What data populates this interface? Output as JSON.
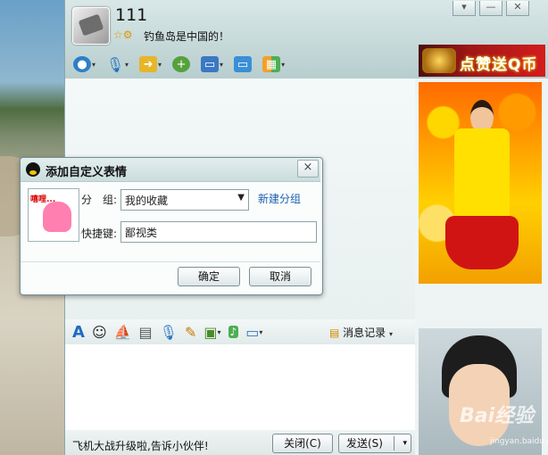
{
  "window": {
    "username": "111",
    "signature": "钓鱼岛是中国的！",
    "status_icons": "☆⚙",
    "buttons": {
      "menu": "▾",
      "minimize": "—",
      "close": "✕"
    }
  },
  "toolbar_top": [
    {
      "name": "video-call",
      "icon": "camera"
    },
    {
      "name": "voice-call",
      "icon": "microphone"
    },
    {
      "name": "send-file",
      "icon": "folder-arrow"
    },
    {
      "name": "add-member",
      "icon": "user-add"
    },
    {
      "name": "remote-assist",
      "icon": "monitor"
    },
    {
      "name": "share-screen",
      "icon": "display"
    },
    {
      "name": "apps",
      "icon": "grid"
    }
  ],
  "ad": {
    "text": "点赞送Q币"
  },
  "input_toolbar": {
    "history_label": "消息记录"
  },
  "bottom": {
    "news": "飞机大战升级啦,告诉小伙伴!",
    "close_label": "关闭(C)",
    "send_label": "发送(S)"
  },
  "watermark": {
    "text": "Bai经验",
    "url_text": "jingyan.baidu.com"
  },
  "dialog": {
    "title": "添加自定义表情",
    "group_label": "分　组:",
    "group_value": "我的收藏",
    "new_group": "新建分组",
    "shortcut_label": "快捷键:",
    "shortcut_value": "鄙视类",
    "emoticon_text": "嘻哩...",
    "ok_label": "确定",
    "cancel_label": "取消",
    "close_icon": "×"
  }
}
